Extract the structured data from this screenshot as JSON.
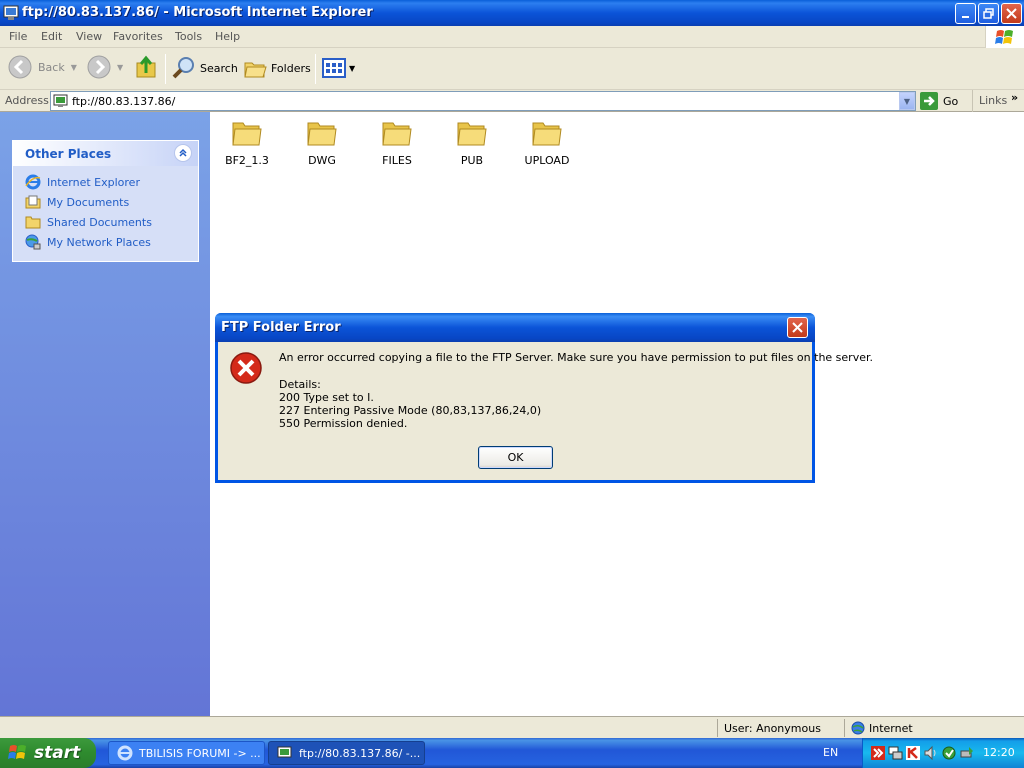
{
  "window": {
    "title": "ftp://80.83.137.86/ - Microsoft Internet Explorer"
  },
  "menu": [
    "File",
    "Edit",
    "View",
    "Favorites",
    "Tools",
    "Help"
  ],
  "toolbar": {
    "back_label": "Back",
    "search_label": "Search",
    "folders_label": "Folders"
  },
  "address": {
    "label": "Address",
    "value": "ftp://80.83.137.86/",
    "go_label": "Go",
    "links_label": "Links"
  },
  "other_places": {
    "title": "Other Places",
    "items": [
      {
        "label": "Internet Explorer",
        "icon": "ie-icon"
      },
      {
        "label": "My Documents",
        "icon": "my-documents-icon"
      },
      {
        "label": "Shared Documents",
        "icon": "folder-icon"
      },
      {
        "label": "My Network Places",
        "icon": "network-icon"
      }
    ]
  },
  "folders": [
    "BF2_1.3",
    "DWG",
    "FILES",
    "PUB",
    "UPLOAD"
  ],
  "dialog": {
    "title": "FTP Folder Error",
    "message": "An error occurred copying a file to the FTP Server.  Make sure you have permission to put files on the server.",
    "details_label": "Details:",
    "details": [
      "200 Type set to I.",
      "227 Entering Passive Mode (80,83,137,86,24,0)",
      "550 Permission denied."
    ],
    "ok_label": "OK"
  },
  "statusbar": {
    "user": "User: Anonymous",
    "zone": "Internet"
  },
  "taskbar": {
    "start_label": "start",
    "tasks": [
      {
        "label": "TBILISIS FORUMI -> ..."
      },
      {
        "label": "ftp://80.83.137.86/ -..."
      }
    ],
    "language": "EN",
    "clock": "12:20"
  },
  "colors": {
    "xp_blue": "#0a54d8",
    "link_blue": "#215dc6",
    "start_green": "#2e8b2e"
  }
}
